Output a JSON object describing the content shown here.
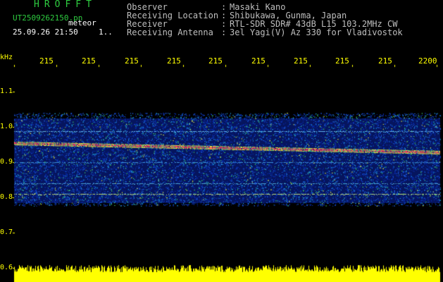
{
  "header": {
    "app_title": "HROFFT",
    "file_name": "UT2509262150.pn",
    "file_suffix": "meteor",
    "timestamp": "25.09.26 21:50",
    "page_indicator": "1.."
  },
  "station": [
    {
      "label": "Observer",
      "sep": ":",
      "value": "Masaki Kano"
    },
    {
      "label": "Receiving Location",
      "sep": ":",
      "value": "Shibukawa, Gunma, Japan"
    },
    {
      "label": "Receiver",
      "sep": ":",
      "value": "RTL-SDR SDR# 43dB L15 103.2MHz CW"
    },
    {
      "label": "Receiving Antenna",
      "sep": ":",
      "value": "3el Yagi(V) Az 330 for Vladivostok"
    }
  ],
  "axes": {
    "y_unit": "kHz",
    "y_ticks": [
      "1.1",
      "1.0",
      "0.9",
      "0.8",
      "0.7",
      "0.6"
    ],
    "x_ticks": [
      "215",
      "215",
      "215",
      "215",
      "215",
      "215",
      "215",
      "215",
      "215",
      "2200"
    ]
  },
  "colors": {
    "background": "#000000",
    "title": "#2ecc40",
    "info_text": "#bfbfbf",
    "axis_text": "#ffff00",
    "noise_band": "#0a2a9a",
    "echo_trace": "#ff3060",
    "signal_bar": "#ffff00"
  }
}
